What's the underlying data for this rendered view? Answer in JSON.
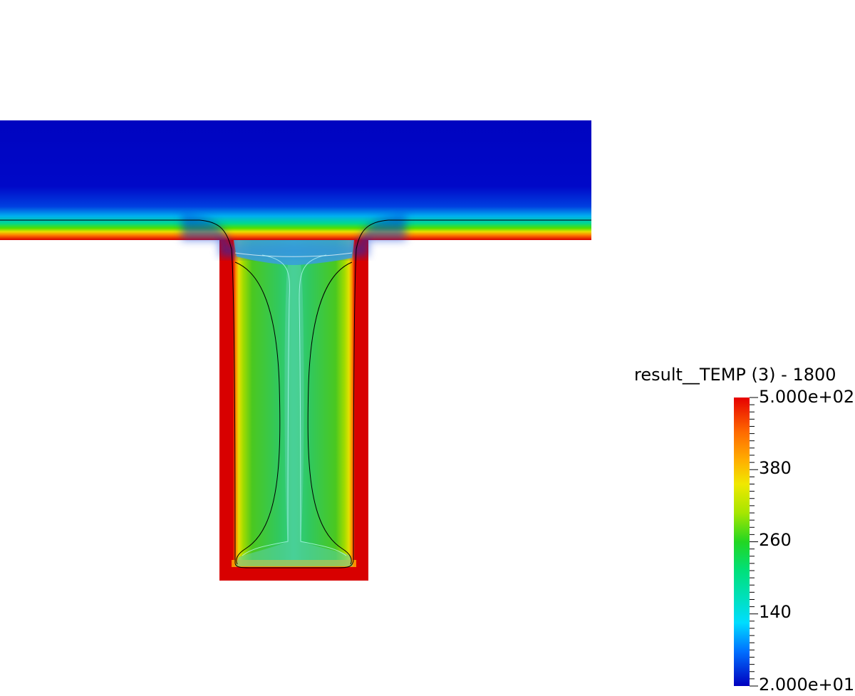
{
  "legend": {
    "title": "result__TEMP (3) - 1800",
    "max_label": "5.000e+02",
    "min_label": "2.000e+01",
    "tick_labels": [
      "380",
      "260",
      "140"
    ],
    "colormap": [
      "#0000bf",
      "#0044ff",
      "#00ddff",
      "#00e07a",
      "#11d611",
      "#a6e600",
      "#f7e600",
      "#ff8800",
      "#e60000"
    ]
  },
  "field": {
    "cold_color": "#0004c0",
    "hot_color": "#d80000",
    "core_color": "#2bd081",
    "stem_center_color": "#5cd2a6",
    "neck_color": "#3aa5dd"
  }
}
